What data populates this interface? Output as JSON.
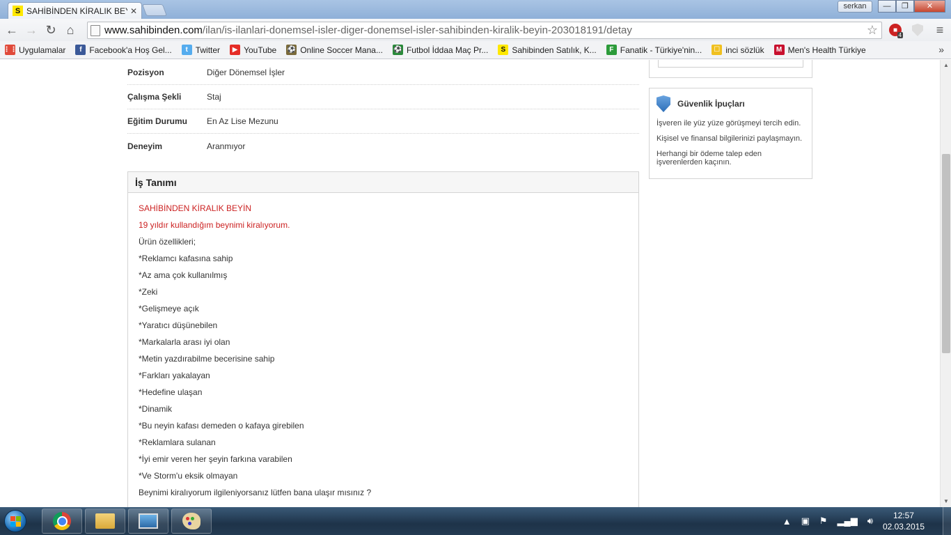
{
  "browser": {
    "tab_title": "SAHİBİNDEN KİRALIK BEYİN",
    "tab_favicon": "S",
    "user_name": "serkan",
    "url_host": "www.sahibinden.com",
    "url_path": "/ilan/is-ilanlari-donemsel-isler-diger-donemsel-isler-sahibinden-kiralik-beyin-203018191/detay",
    "adblock_count": "4",
    "win_minimize": "—",
    "win_maximize": "❐",
    "win_close": "✕"
  },
  "bookmarks": [
    {
      "label": "Uygulamalar",
      "icon": "apps-grid-icon",
      "color": "#e04a3a"
    },
    {
      "label": "Facebook'a Hoş Gel...",
      "icon": "facebook-icon",
      "color": "#3b5998"
    },
    {
      "label": "Twitter",
      "icon": "twitter-icon",
      "color": "#55acee"
    },
    {
      "label": "YouTube",
      "icon": "youtube-icon",
      "color": "#e52d27"
    },
    {
      "label": "Online Soccer Mana...",
      "icon": "soccer-manager-icon",
      "color": "#7a6a3a"
    },
    {
      "label": "Futbol İddaa Maç Pr...",
      "icon": "football-icon",
      "color": "#2a8a3a"
    },
    {
      "label": "Sahibinden Satılık, K...",
      "icon": "sahibinden-icon",
      "color": "#ffe800"
    },
    {
      "label": "Fanatik - Türkiye'nin...",
      "icon": "fanatik-icon",
      "color": "#2c9b3a"
    },
    {
      "label": "inci sözlük",
      "icon": "inci-sozluk-icon",
      "color": "#f0c020"
    },
    {
      "label": "Men's Health Türkiye",
      "icon": "mens-health-icon",
      "color": "#c8102e"
    }
  ],
  "details": [
    {
      "label": "Pozisyon",
      "value": "Diğer Dönemsel İşler"
    },
    {
      "label": "Çalışma Şekli",
      "value": "Staj"
    },
    {
      "label": "Eğitim Durumu",
      "value": "En Az Lise Mezunu"
    },
    {
      "label": "Deneyim",
      "value": "Aranmıyor"
    }
  ],
  "description": {
    "title": "İş Tanımı",
    "lines": [
      "SAHİBİNDEN KİRALIK BEYİN",
      "19 yıldır kullandığım beynimi kiralıyorum.",
      "Ürün özellikleri;",
      "*Reklamcı kafasına sahip",
      "*Az ama çok kullanılmış",
      "*Zeki",
      "*Gelişmeye açık",
      "*Yaratıcı düşünebilen",
      "*Markalarla arası iyi olan",
      "*Metin yazdırabilme becerisine sahip",
      "*Farkları yakalayan",
      "*Hedefine ulaşan",
      "*Dinamik",
      "*Bu neyin kafası demeden o kafaya girebilen",
      "*Reklamlara sulanan",
      "*İyi emir veren her şeyin farkına varabilen",
      "*Ve Storm'u eksik olmayan",
      "Beynimi kiralıyorum ilgileniyorsanız lütfen bana ulaşır mısınız ?"
    ]
  },
  "safety": {
    "title": "Güvenlik İpuçları",
    "tips": [
      "İşveren ile yüz yüze görüşmeyi tercih edin.",
      "Kişisel ve finansal bilgilerinizi paylaşmayın.",
      "Herhangi bir ödeme talep eden işverenlerden kaçının."
    ]
  },
  "taskbar": {
    "time": "12:57",
    "date": "02.03.2015"
  },
  "colors": {
    "accent_red": "#cc2222",
    "sahibinden_yellow": "#ffe800"
  }
}
